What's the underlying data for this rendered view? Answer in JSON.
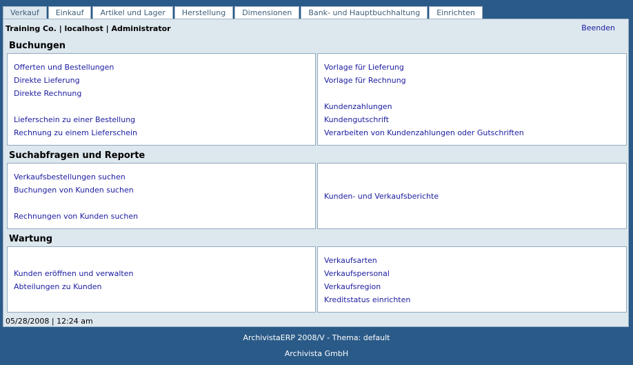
{
  "tabs": [
    "Verkauf",
    "Einkauf",
    "Artikel und Lager",
    "Herstellung",
    "Dimensionen",
    "Bank- und Hauptbuchhaltung",
    "Einrichten"
  ],
  "header": {
    "company_info": "Training Co. | localhost | Administrator",
    "logout_label": "Beenden"
  },
  "sections": {
    "buchungen": {
      "title": "Buchungen",
      "left": [
        "Offerten und Bestellungen",
        "Direkte Lieferung",
        "Direkte Rechnung",
        "Lieferschein zu einer Bestellung",
        "Rechnung zu einem Lieferschein"
      ],
      "right": [
        "Vorlage für Lieferung",
        "Vorlage für Rechnung",
        "Kundenzahlungen",
        "Kundengutschrift",
        "Verarbeiten von Kundenzahlungen oder Gutschriften"
      ]
    },
    "suchabfragen": {
      "title": "Suchabfragen und Reporte",
      "left": [
        "Verkaufsbestellungen suchen",
        "Buchungen von Kunden suchen",
        "Rechnungen von Kunden suchen"
      ],
      "right": [
        "Kunden- und Verkaufsberichte"
      ]
    },
    "wartung": {
      "title": "Wartung",
      "left": [
        "Kunden eröffnen und verwalten",
        "Abteilungen zu Kunden"
      ],
      "right": [
        "Verkaufsarten",
        "Verkaufspersonal",
        "Verkaufsregion",
        "Kreditstatus einrichten"
      ]
    }
  },
  "status": {
    "datetime": "05/28/2008 | 12:24 am"
  },
  "footer": {
    "line1": "ArchivistaERP 2008/V - Thema: default",
    "line2": "Archivista GmbH"
  }
}
